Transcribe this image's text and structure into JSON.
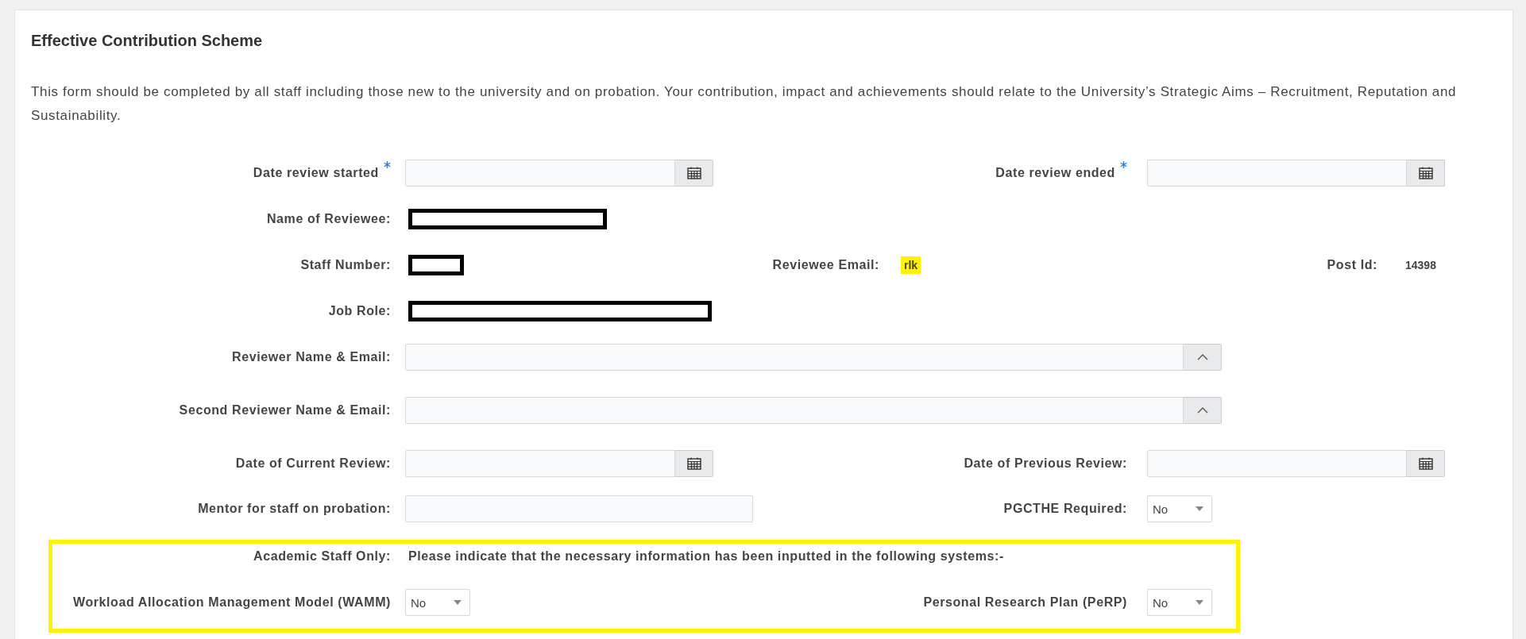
{
  "title": "Effective Contribution Scheme",
  "intro": "This form should be completed by all staff including those new to the university and on probation. Your contribution, impact and achievements should relate to the University’s Strategic Aims – Recruitment, Reputation and Sustainability.",
  "rows": [
    {
      "kind": "pair",
      "fields": [
        {
          "kind": "date",
          "label": "Date review started",
          "required": true
        },
        {
          "kind": "date",
          "label": "Date review ended",
          "required": true
        }
      ]
    },
    {
      "kind": "pair",
      "fields": [
        {
          "kind": "redacted",
          "label": "Name of Reviewee:"
        }
      ]
    },
    {
      "kind": "triple",
      "fields": [
        {
          "kind": "redacted",
          "label": "Staff Number:"
        },
        {
          "kind": "static",
          "label": "Reviewee Email:",
          "value": "rlk",
          "highlighted": true
        },
        {
          "kind": "static",
          "label": "Post Id:",
          "value": "14398",
          "highlighted": false
        }
      ]
    },
    {
      "kind": "pair",
      "fields": [
        {
          "kind": "redacted",
          "label": "Job Role:"
        }
      ]
    },
    {
      "kind": "wide",
      "fields": [
        {
          "kind": "lookup",
          "label": "Reviewer Name & Email:"
        }
      ]
    },
    {
      "kind": "wide",
      "fields": [
        {
          "kind": "lookup",
          "label": "Second Reviewer Name & Email:"
        }
      ]
    },
    {
      "kind": "pair",
      "fields": [
        {
          "kind": "date",
          "label": "Date of Current Review:",
          "required": false
        },
        {
          "kind": "date",
          "label": "Date of Previous Review:",
          "required": false
        }
      ]
    },
    {
      "kind": "pair",
      "fields": [
        {
          "kind": "text",
          "label": "Mentor for staff on probation:"
        },
        {
          "kind": "select",
          "label": "PGCTHE Required:",
          "value": "No"
        }
      ]
    }
  ],
  "section": {
    "highlighted": true,
    "label": "Academic Staff Only:",
    "note": "Please indicate that the necessary information has been inputted in the following systems:-",
    "fields": [
      {
        "kind": "select",
        "label": "Workload Allocation Management Model (WAMM)",
        "value": "No"
      },
      {
        "kind": "select",
        "label": "Personal Research Plan (PeRP)",
        "value": "No"
      }
    ]
  }
}
